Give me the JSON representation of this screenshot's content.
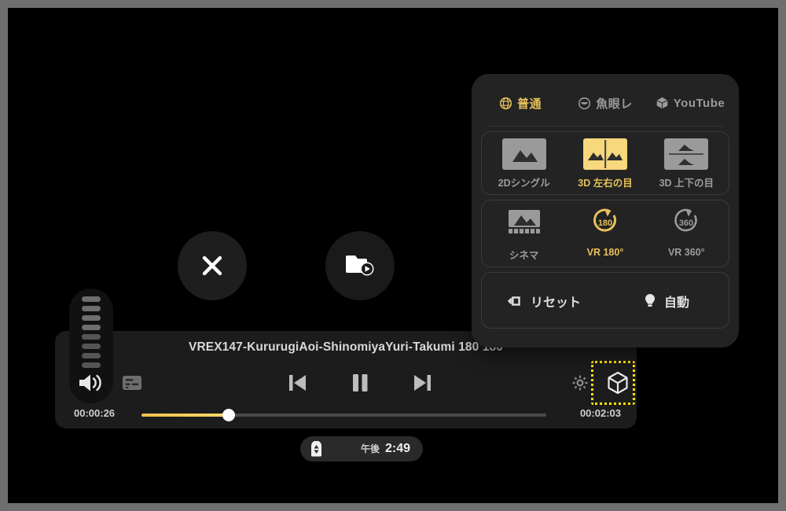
{
  "player": {
    "title": "VREX147-KururugiAoi-ShinomiyaYuri-Takumi 180 180",
    "current_time": "00:00:26",
    "total_time": "00:02:03",
    "progress_percent": 21.5,
    "state": "playing",
    "controls": {
      "subtitles": "cc-icon",
      "previous": "previous-track-icon",
      "play_pause": "pause-icon",
      "next": "next-track-icon",
      "settings": "gear-icon",
      "video_mode": "cube-3d-icon"
    },
    "volume": {
      "icon": "speaker-icon",
      "segments": 8,
      "filled": 8
    }
  },
  "overlay_buttons": [
    {
      "name": "close",
      "icon": "close-x-icon"
    },
    {
      "name": "media-library",
      "icon": "folder-play-icon"
    }
  ],
  "mode_panel": {
    "tabs": [
      {
        "label": "普通",
        "icon": "globe-icon",
        "active": true
      },
      {
        "label": "魚眼レ",
        "icon": "fisheye-icon",
        "active": false
      },
      {
        "label": "YouTube",
        "icon": "cube-icon",
        "active": false
      }
    ],
    "stereo_options": [
      {
        "label": "2Dシングル",
        "icon": "image-single-icon",
        "active": false
      },
      {
        "label": "3D 左右の目",
        "icon": "image-side-by-side-icon",
        "active": true
      },
      {
        "label": "3D 上下の目",
        "icon": "image-over-under-icon",
        "active": false
      }
    ],
    "projection_options": [
      {
        "label": "シネマ",
        "icon": "cinema-screen-icon",
        "active": false
      },
      {
        "label": "VR 180°",
        "icon": "vr-180-icon",
        "active": true
      },
      {
        "label": "VR 360°",
        "icon": "vr-360-icon",
        "active": false
      }
    ],
    "actions": [
      {
        "label": "リセット",
        "icon": "reset-icon"
      },
      {
        "label": "自動",
        "icon": "bulb-icon"
      }
    ]
  },
  "taskbar": {
    "battery_icon": "battery-icon",
    "am_pm": "午後",
    "time": "2:49"
  },
  "colors": {
    "accent": "#E8C15C",
    "focus": "#FFE100",
    "panel_bg": "#232323",
    "bar_bg": "#1c1c1c"
  }
}
